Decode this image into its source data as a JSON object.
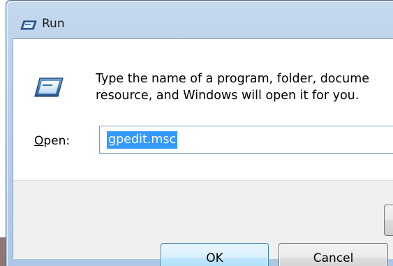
{
  "window": {
    "title": "Run",
    "icon": "run-icon"
  },
  "dialog": {
    "instructions_line1": "Type the name of a program, folder, docume",
    "instructions_line2": "resource, and Windows will open it for you.",
    "open_label_mnemonic": "O",
    "open_label_rest": "pen:",
    "open_value": "gpedit.msc",
    "icon": "run-icon"
  },
  "buttons": {
    "ok_label": "OK",
    "cancel_label": "Cancel"
  },
  "colors": {
    "selection": "#3399ff",
    "frame": "#b9cfe8",
    "button_bar": "#f0f0f0"
  }
}
